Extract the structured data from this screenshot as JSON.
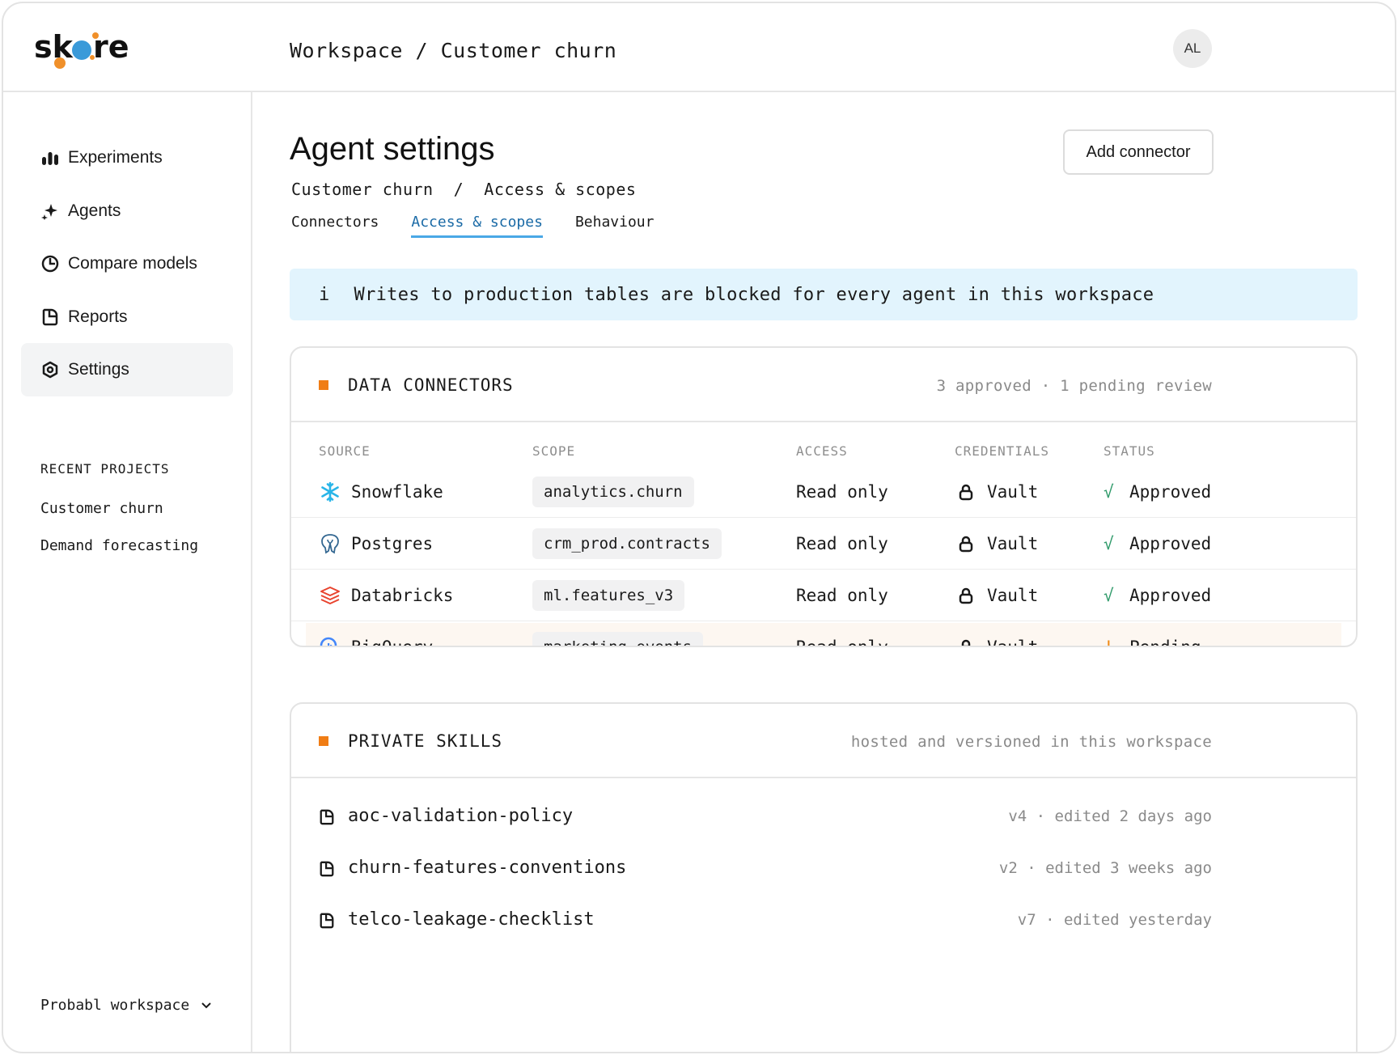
{
  "app": {
    "logo_text": "skore",
    "brand_colors": {
      "orange": "#f0902a",
      "blue": "#3a9ad9"
    }
  },
  "header": {
    "breadcrumb": "Workspace / Customer churn",
    "avatar_initials": "AL"
  },
  "sidebar": {
    "items": [
      {
        "label": "Experiments",
        "icon": "bar-chart-icon"
      },
      {
        "label": "Agents",
        "icon": "sparkle-icon"
      },
      {
        "label": "Compare models",
        "icon": "pie-chart-icon"
      },
      {
        "label": "Reports",
        "icon": "report-icon"
      },
      {
        "label": "Settings",
        "icon": "gear-icon",
        "active": true
      }
    ],
    "recent_title": "RECENT PROJECTS",
    "recent_projects": [
      "Customer churn",
      "Demand forecasting"
    ],
    "workspace": "Probabl workspace"
  },
  "main": {
    "title": "Agent settings",
    "add_button": "Add connector",
    "breadcrumb": "Customer churn  /  Access & scopes",
    "tabs": [
      {
        "label": "Connectors",
        "active": false
      },
      {
        "label": "Access & scopes",
        "active": true
      },
      {
        "label": "Behaviour",
        "active": false
      }
    ],
    "banner": {
      "icon": "i",
      "text": "Writes to production tables are blocked for every agent in this workspace"
    },
    "connectors": {
      "title": "DATA CONNECTORS",
      "meta": "3 approved · 1 pending review",
      "columns": [
        "SOURCE",
        "SCOPE",
        "ACCESS",
        "CREDENTIALS",
        "STATUS"
      ],
      "rows": [
        {
          "source": "Snowflake",
          "icon": "snowflake-icon",
          "scope": "analytics.churn",
          "access": "Read only",
          "credentials": "Vault",
          "status_mark": "√",
          "status": "Approved"
        },
        {
          "source": "Postgres",
          "icon": "postgres-icon",
          "scope": "crm_prod.contracts",
          "access": "Read only",
          "credentials": "Vault",
          "status_mark": "√",
          "status": "Approved"
        },
        {
          "source": "Databricks",
          "icon": "databricks-icon",
          "scope": "ml.features_v3",
          "access": "Read only",
          "credentials": "Vault",
          "status_mark": "√",
          "status": "Approved"
        },
        {
          "source": "BigQuery",
          "icon": "bigquery-icon",
          "scope": "marketing.events",
          "access": "Read only",
          "credentials": "Vault",
          "status_mark": "!",
          "status": "Pending"
        }
      ]
    },
    "skills": {
      "title": "PRIVATE SKILLS",
      "meta": "hosted and versioned in this workspace",
      "items": [
        {
          "name": "aoc-validation-policy",
          "meta": "v4 · edited 2 days ago"
        },
        {
          "name": "churn-features-conventions",
          "meta": "v2 · edited 3 weeks ago"
        },
        {
          "name": "telco-leakage-checklist",
          "meta": "v7 · edited yesterday"
        }
      ]
    }
  }
}
